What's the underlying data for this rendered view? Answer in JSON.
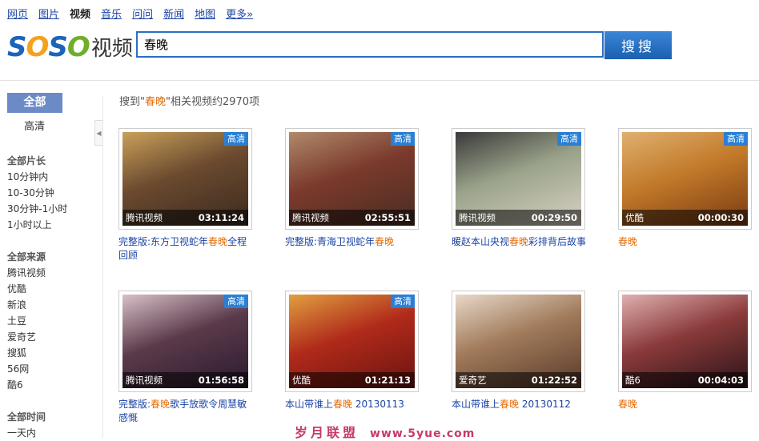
{
  "nav": [
    "网页",
    "图片",
    "视频",
    "音乐",
    "问问",
    "新闻",
    "地图",
    "更多»"
  ],
  "nav_active": 2,
  "logo": {
    "s1": "S",
    "o1": "O",
    "s2": "S",
    "o2": "O",
    "sub": "视频"
  },
  "search": {
    "value": "春晚",
    "button": "搜搜"
  },
  "sidebar": {
    "all": "全部",
    "hd": "高清",
    "sections": [
      {
        "title": "全部片长",
        "items": [
          "10分钟内",
          "10-30分钟",
          "30分钟-1小时",
          "1小时以上"
        ]
      },
      {
        "title": "全部来源",
        "items": [
          "腾讯视频",
          "优酷",
          "新浪",
          "土豆",
          "爱奇艺",
          "搜狐",
          "56网",
          "酷6"
        ]
      },
      {
        "title": "全部时间",
        "items": [
          "一天内"
        ]
      }
    ]
  },
  "result_info": {
    "prefix": "搜到\"",
    "keyword": "春晚",
    "suffix": "\"相关视频约2970项"
  },
  "videos": [
    {
      "source": "腾讯视频",
      "duration": "03:11:24",
      "hd": "高清",
      "t1": "完整版:东方卫视蛇年",
      "kw": "春晚",
      "t2": "全程回顾",
      "colors": [
        "#3a2a1e",
        "#6b4a2f",
        "#c9a15a"
      ]
    },
    {
      "source": "腾讯视频",
      "duration": "02:55:51",
      "hd": "高清",
      "t1": "完整版:青海卫视蛇年",
      "kw": "春晚",
      "t2": "",
      "colors": [
        "#4a2c22",
        "#7a3a2c",
        "#b08a6a"
      ]
    },
    {
      "source": "腾讯视频",
      "duration": "00:29:50",
      "hd": "高清",
      "t1": "暖赵本山央视",
      "kw": "春晚",
      "t2": "彩排背后故事",
      "colors": [
        "#d9d2c4",
        "#9aa38a",
        "#3a3a3a"
      ]
    },
    {
      "source": "优酷",
      "duration": "00:00:30",
      "hd": "高清",
      "t1": "",
      "kw": "春晚",
      "t2": "",
      "colors": [
        "#7a3a12",
        "#c27a2a",
        "#e0b070"
      ]
    },
    {
      "source": "腾讯视频",
      "duration": "01:56:58",
      "hd": "高清",
      "t1": "完整版:",
      "kw": "春晚",
      "t2": "歌手放歌令周慧敏感慨",
      "colors": [
        "#2a1a2e",
        "#5a3a4a",
        "#d8c0c8"
      ]
    },
    {
      "source": "优酷",
      "duration": "01:21:13",
      "hd": "高清",
      "t1": "本山带谁上",
      "kw": "春晚",
      "t2": " 20130113",
      "colors": [
        "#6a1410",
        "#b02a1a",
        "#e0a040"
      ]
    },
    {
      "source": "爱奇艺",
      "duration": "01:22:52",
      "hd": "",
      "t1": "本山带谁上",
      "kw": "春晚",
      "t2": " 20130112",
      "colors": [
        "#5a3a2a",
        "#a07a5a",
        "#e8d8c8"
      ]
    },
    {
      "source": "酷6",
      "duration": "00:04:03",
      "hd": "",
      "t1": "",
      "kw": "春晚",
      "t2": "",
      "colors": [
        "#2a1418",
        "#8a3a3a",
        "#e0b0b0"
      ]
    }
  ],
  "watermark": {
    "text": "岁月联盟",
    "url": "www.5yue.com"
  }
}
